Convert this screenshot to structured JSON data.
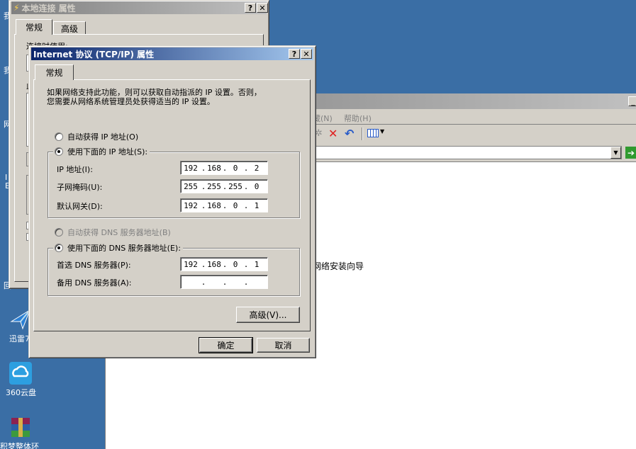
{
  "desktop": {
    "icons": [
      {
        "name": "thunder",
        "label": "迅雷7"
      },
      {
        "name": "yunpan",
        "label": "360云盘"
      },
      {
        "name": "winrar",
        "label": "积梦整体环"
      }
    ],
    "fragments": [
      "我",
      "我",
      "网",
      "I",
      "E",
      "回"
    ]
  },
  "explorer": {
    "menu": {
      "fav_partial": "藏(N)",
      "help": "帮助(H)"
    },
    "content_text": "网络安装向导"
  },
  "back_dialog": {
    "title": "本地连接 属性",
    "tabs": [
      "常规",
      "高级"
    ],
    "connect_using": "连接时使用:",
    "this_conn": "此"
  },
  "tcpip": {
    "title": "Internet 协议 (TCP/IP) 属性",
    "help_btn": "?",
    "close_btn": "✕",
    "tab": "常规",
    "intro": "如果网络支持此功能，则可以获取自动指派的 IP 设置。否则，\n您需要从网络系统管理员处获得适当的 IP 设置。",
    "auto_ip": "自动获得 IP 地址(O)",
    "manual_ip": "使用下面的 IP 地址(S):",
    "ip_label": "IP 地址(I):",
    "ip": [
      "192",
      "168",
      "0",
      "2"
    ],
    "mask_label": "子网掩码(U):",
    "mask": [
      "255",
      "255",
      "255",
      "0"
    ],
    "gw_label": "默认网关(D):",
    "gw": [
      "192",
      "168",
      "0",
      "1"
    ],
    "auto_dns": "自动获得 DNS 服务器地址(B)",
    "manual_dns": "使用下面的 DNS 服务器地址(E):",
    "dns1_label": "首选 DNS 服务器(P):",
    "dns1": [
      "192",
      "168",
      "0",
      "1"
    ],
    "dns2_label": "备用 DNS 服务器(A):",
    "dns2": [
      "",
      "",
      "",
      ""
    ],
    "advanced": "高级(V)...",
    "ok": "确定",
    "cancel": "取消",
    "selected": {
      "ip": "manual",
      "dns": "manual"
    }
  },
  "colors": {
    "desktop": "#3a6ea5",
    "active_title": "#0a246a",
    "face": "#d4d0c8"
  }
}
